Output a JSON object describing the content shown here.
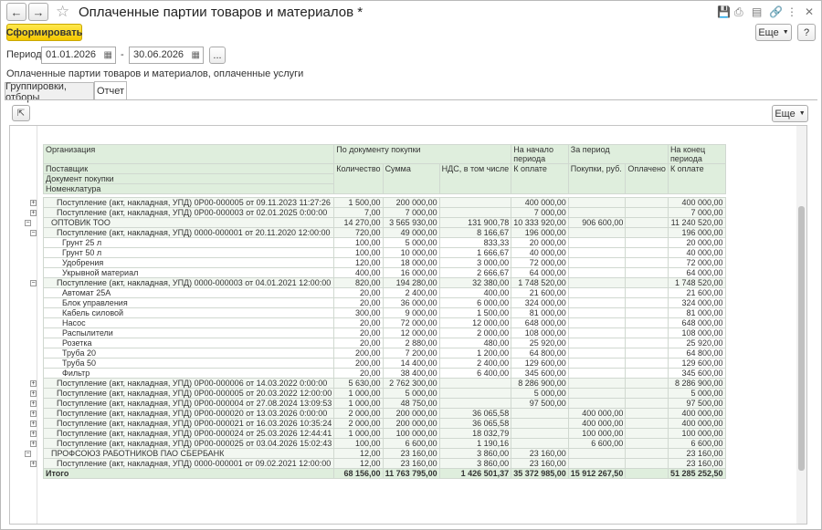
{
  "window": {
    "title": "Оплаченные партии товаров и материалов *"
  },
  "toolbar": {
    "generate": "Сформировать",
    "more": "Еще",
    "help": "?"
  },
  "period": {
    "label": "Период:",
    "from": "01.01.2026",
    "to": "30.06.2026",
    "dash": "-",
    "ellipsis": "..."
  },
  "description": "Оплаченные партии товаров и материалов, оплаченные услуги",
  "tabs": [
    "Группировки, отборы",
    "Отчет"
  ],
  "report_more": "Еще",
  "headers": {
    "org": "Организация",
    "supplier": "Поставщик",
    "doc": "Документ покупки",
    "nom": "Номенклатура",
    "by_doc": "По документу покупки",
    "qty": "Количество",
    "sum": "Сумма",
    "vat": "НДС, в том числе",
    "start": "На начало периода",
    "to_pay": "К оплате",
    "period": "За период",
    "purchases": "Покупки, руб.",
    "paid": "Оплачено",
    "end": "На конец периода",
    "to_pay2": "К оплате"
  },
  "rows": [
    {
      "lvl": 2,
      "t": "g",
      "name": "Поступление (акт, накладная, УПД) 0Р00-000005 от 09.11.2023 11:27:26",
      "v": [
        "1 500,00",
        "200 000,00",
        "",
        "400 000,00",
        "",
        "",
        "400 000,00"
      ]
    },
    {
      "lvl": 2,
      "t": "g",
      "name": "Поступление (акт, накладная, УПД) 0Р00-000003 от 02.01.2025 0:00:00",
      "v": [
        "7,00",
        "7 000,00",
        "",
        "7 000,00",
        "",
        "",
        "7 000,00"
      ]
    },
    {
      "lvl": 1,
      "t": "g",
      "name": "ОПТОВИК ТОО",
      "v": [
        "14 270,00",
        "3 565 930,00",
        "131 900,78",
        "10 333 920,00",
        "906 600,00",
        "",
        "11 240 520,00"
      ]
    },
    {
      "lvl": 2,
      "t": "g",
      "name": "Поступление (акт, накладная, УПД) 0000-000001 от 20.11.2020 12:00:00",
      "v": [
        "720,00",
        "49 000,00",
        "8 166,67",
        "196 000,00",
        "",
        "",
        "196 000,00"
      ]
    },
    {
      "lvl": 3,
      "t": "r",
      "name": "Грунт 25 л",
      "v": [
        "100,00",
        "5 000,00",
        "833,33",
        "20 000,00",
        "",
        "",
        "20 000,00"
      ]
    },
    {
      "lvl": 3,
      "t": "r",
      "name": "Грунт 50 л",
      "v": [
        "100,00",
        "10 000,00",
        "1 666,67",
        "40 000,00",
        "",
        "",
        "40 000,00"
      ]
    },
    {
      "lvl": 3,
      "t": "r",
      "name": "Удобрения",
      "v": [
        "120,00",
        "18 000,00",
        "3 000,00",
        "72 000,00",
        "",
        "",
        "72 000,00"
      ]
    },
    {
      "lvl": 3,
      "t": "r",
      "name": "Укрывной материал",
      "v": [
        "400,00",
        "16 000,00",
        "2 666,67",
        "64 000,00",
        "",
        "",
        "64 000,00"
      ]
    },
    {
      "lvl": 2,
      "t": "g",
      "name": "Поступление (акт, накладная, УПД) 0000-000003 от 04.01.2021 12:00:00",
      "v": [
        "820,00",
        "194 280,00",
        "32 380,00",
        "1 748 520,00",
        "",
        "",
        "1 748 520,00"
      ]
    },
    {
      "lvl": 3,
      "t": "r",
      "name": "Автомат 25А",
      "v": [
        "20,00",
        "2 400,00",
        "400,00",
        "21 600,00",
        "",
        "",
        "21 600,00"
      ]
    },
    {
      "lvl": 3,
      "t": "r",
      "name": "Блок управления",
      "v": [
        "20,00",
        "36 000,00",
        "6 000,00",
        "324 000,00",
        "",
        "",
        "324 000,00"
      ]
    },
    {
      "lvl": 3,
      "t": "r",
      "name": "Кабель силовой",
      "v": [
        "300,00",
        "9 000,00",
        "1 500,00",
        "81 000,00",
        "",
        "",
        "81 000,00"
      ]
    },
    {
      "lvl": 3,
      "t": "r",
      "name": "Насос",
      "v": [
        "20,00",
        "72 000,00",
        "12 000,00",
        "648 000,00",
        "",
        "",
        "648 000,00"
      ]
    },
    {
      "lvl": 3,
      "t": "r",
      "name": "Распылители",
      "v": [
        "20,00",
        "12 000,00",
        "2 000,00",
        "108 000,00",
        "",
        "",
        "108 000,00"
      ]
    },
    {
      "lvl": 3,
      "t": "r",
      "name": "Розетка",
      "v": [
        "20,00",
        "2 880,00",
        "480,00",
        "25 920,00",
        "",
        "",
        "25 920,00"
      ]
    },
    {
      "lvl": 3,
      "t": "r",
      "name": "Труба 20",
      "v": [
        "200,00",
        "7 200,00",
        "1 200,00",
        "64 800,00",
        "",
        "",
        "64 800,00"
      ]
    },
    {
      "lvl": 3,
      "t": "r",
      "name": "Труба 50",
      "v": [
        "200,00",
        "14 400,00",
        "2 400,00",
        "129 600,00",
        "",
        "",
        "129 600,00"
      ]
    },
    {
      "lvl": 3,
      "t": "r",
      "name": "Фильтр",
      "v": [
        "20,00",
        "38 400,00",
        "6 400,00",
        "345 600,00",
        "",
        "",
        "345 600,00"
      ]
    },
    {
      "lvl": 2,
      "t": "g",
      "name": "Поступление (акт, накладная, УПД) 0Р00-000006 от 14.03.2022 0:00:00",
      "v": [
        "5 630,00",
        "2 762 300,00",
        "",
        "8 286 900,00",
        "",
        "",
        "8 286 900,00"
      ]
    },
    {
      "lvl": 2,
      "t": "g",
      "name": "Поступление (акт, накладная, УПД) 0Р00-000005 от 20.03.2022 12:00:00",
      "v": [
        "1 000,00",
        "5 000,00",
        "",
        "5 000,00",
        "",
        "",
        "5 000,00"
      ]
    },
    {
      "lvl": 2,
      "t": "g",
      "name": "Поступление (акт, накладная, УПД) 0Р00-000004 от 27.08.2024 13:09:53",
      "v": [
        "1 000,00",
        "48 750,00",
        "",
        "97 500,00",
        "",
        "",
        "97 500,00"
      ]
    },
    {
      "lvl": 2,
      "t": "g",
      "name": "Поступление (акт, накладная, УПД) 0Р00-000020 от 13.03.2026 0:00:00",
      "v": [
        "2 000,00",
        "200 000,00",
        "36 065,58",
        "",
        "400 000,00",
        "",
        "400 000,00"
      ]
    },
    {
      "lvl": 2,
      "t": "g",
      "name": "Поступление (акт, накладная, УПД) 0Р00-000021 от 16.03.2026 10:35:24",
      "v": [
        "2 000,00",
        "200 000,00",
        "36 065,58",
        "",
        "400 000,00",
        "",
        "400 000,00"
      ]
    },
    {
      "lvl": 2,
      "t": "g",
      "name": "Поступление (акт, накладная, УПД) 0Р00-000024 от 25.03.2026 12:44:41",
      "v": [
        "1 000,00",
        "100 000,00",
        "18 032,79",
        "",
        "100 000,00",
        "",
        "100 000,00"
      ]
    },
    {
      "lvl": 2,
      "t": "g",
      "name": "Поступление (акт, накладная, УПД) 0Р00-000025 от 03.04.2026 15:02:43",
      "v": [
        "100,00",
        "6 600,00",
        "1 190,16",
        "",
        "6 600,00",
        "",
        "6 600,00"
      ]
    },
    {
      "lvl": 1,
      "t": "g",
      "name": "ПРОФСОЮЗ РАБОТНИКОВ ПАО СБЕРБАНК",
      "v": [
        "12,00",
        "23 160,00",
        "3 860,00",
        "23 160,00",
        "",
        "",
        "23 160,00"
      ]
    },
    {
      "lvl": 2,
      "t": "g",
      "name": "Поступление (акт, накладная, УПД) 0000-000001 от 09.02.2021 12:00:00",
      "v": [
        "12,00",
        "23 160,00",
        "3 860,00",
        "23 160,00",
        "",
        "",
        "23 160,00"
      ]
    }
  ],
  "total": {
    "name": "Итого",
    "v": [
      "68 156,00",
      "11 763 795,00",
      "1 426 501,37",
      "35 372 985,00",
      "15 912 267,50",
      "",
      "51 285 252,50"
    ]
  }
}
